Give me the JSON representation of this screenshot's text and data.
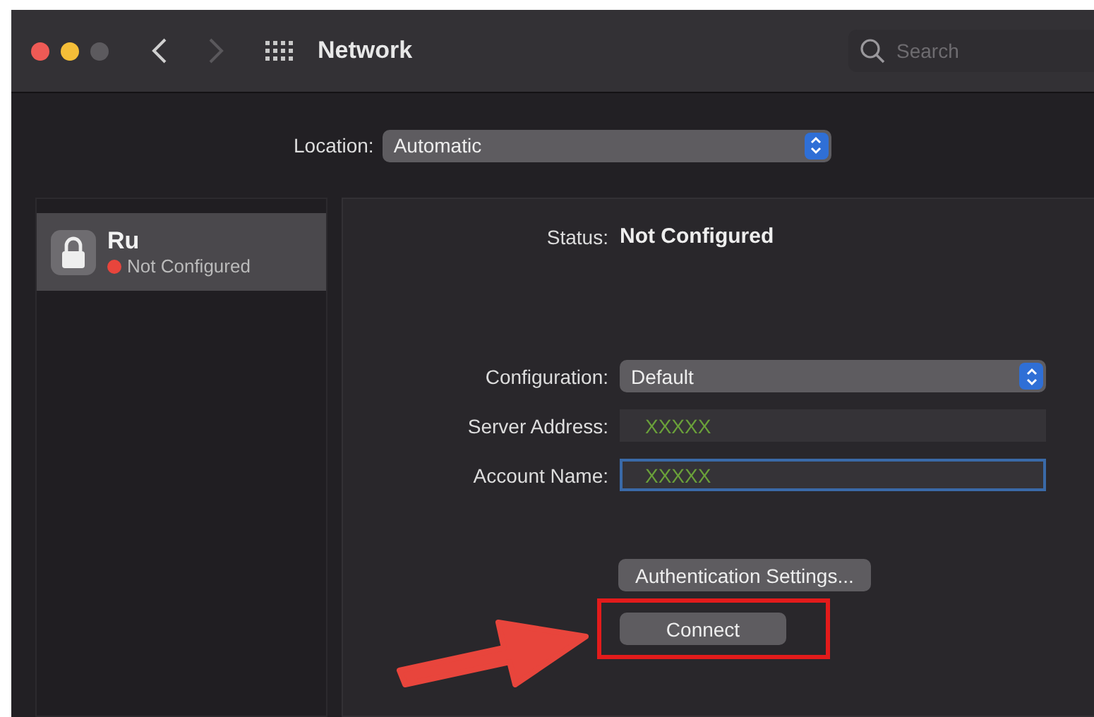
{
  "window": {
    "title": "Network",
    "search": {
      "placeholder": "Search"
    }
  },
  "location": {
    "label": "Location:",
    "value": "Automatic"
  },
  "sidebar": {
    "items": [
      {
        "name": "Ru",
        "status": "Not Configured",
        "color": "#e8453c",
        "selected": true
      }
    ]
  },
  "detail": {
    "status_label": "Status:",
    "status": "Not Configured",
    "fields": [
      {
        "kind": "popup",
        "label": "Configuration:",
        "value": "Default",
        "focused": false
      },
      {
        "kind": "text",
        "label": "Server Address:",
        "value": "XXXXX",
        "focused": false
      },
      {
        "kind": "text",
        "label": "Account Name:",
        "value": "XXXXX",
        "focused": true
      }
    ],
    "buttons": [
      {
        "label": "Authentication Settings...",
        "highlighted": false
      },
      {
        "label": "Connect",
        "highlighted": true
      }
    ]
  }
}
